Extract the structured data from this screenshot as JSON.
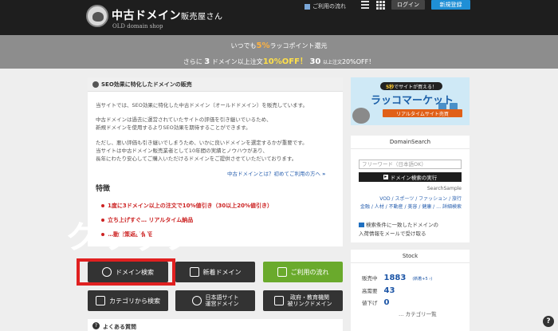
{
  "header": {
    "logo_title": "中古ドメイン",
    "logo_title_suffix": "販売屋さん",
    "logo_sub": "OLD domain shop",
    "flow_label": "ご利用の流れ",
    "login_label": "ログイン",
    "register_label": "新規登録"
  },
  "campaign": {
    "line1_pre": "いつでも",
    "line1_pct": "5%",
    "line1_post": "ラッコポイント還元",
    "line2_pre": "さらに",
    "line2_num": "3",
    "line2_mid": "ドメイン以上注文",
    "line2_off": "10%OFF！",
    "line2_tiny_num": "30",
    "line2_tiny": "以上注文",
    "line2_end": "20%OFF！"
  },
  "main": {
    "title": "SEO効果に特化したドメインの販売",
    "paragraphs": [
      "当サイトでは、SEO効果に特化した中古ドメイン（オールドドメイン）を販売しています。",
      "中古ドメインは過去に運営されていたサイトの評価を引き継いでいるため、",
      "新規ドメインを使用するよりSEO効果を期待することができます。",
      "ただし、悪い評価も引き継いでしまうため、いかに良いドメインを選定するかが重要です。",
      "当サイトは中古ドメイン販売業者として10年間の実績とノウハウがあり、",
      "長年にわたり安心してご購入いただけるドメインをご提供させていただいております。"
    ],
    "first_link": "中古ドメインとは？初めてご利用の方へ",
    "features_heading": "特徴",
    "features": [
      "1度に3ドメイン以上の注文で10%値引き（30以上20%値引き）",
      "立ち上げすぐ… リアルタイム納品",
      "…動対策返品保証"
    ]
  },
  "overlay_text": "クリック",
  "actions": {
    "domain_search": "ドメイン検索",
    "new_domain": "新着ドメイン",
    "usage_flow": "ご利用の流れ",
    "category_search": "カテゴリから検索",
    "jp_site_line1": "日本語サイト",
    "jp_site_line2": "運営ドメイン",
    "gov_line1": "政府・教育機関",
    "gov_line2": "被リンクドメイン"
  },
  "faq": {
    "title": "よくある質問",
    "q_mark": "?"
  },
  "banner": {
    "top_pre": "5秒",
    "top_post": "でサイトが買える！",
    "main": "ラッコマーケット",
    "sub": "リアルタイムサイト売買"
  },
  "domain_search": {
    "heading": "DomainSearch",
    "placeholder": "フリーワード（日本語OK）",
    "button": "ドメイン検索の実行",
    "sample_label": "SearchSample",
    "links_line1": "VOD / スポーツ / ファッション / 旅行",
    "links_line2": "金融 / 人材 / 不動産 / 美容 / 健康 / … 詳細検索",
    "notice_line1": "検索条件に一致したドメインの",
    "notice_line2": "入荷情報をメールで受け取る"
  },
  "stock": {
    "heading": "Stock",
    "rows": [
      {
        "label": "販売中",
        "value": "1883",
        "small": "(新着+5 ›)"
      },
      {
        "label": "高需要",
        "value": "43",
        "small": ""
      },
      {
        "label": "値下げ",
        "value": "0",
        "small": ""
      }
    ],
    "more": "… カテゴリ一覧"
  },
  "help_label": "?",
  "colors": {
    "header_bg": "#1e1e1e",
    "campaign_bg": "#8d8d8d",
    "accent_orange": "#ffb23f",
    "green_button": "#6aaa2c",
    "highlight_red": "#e02020",
    "link_blue": "#2b62b0"
  }
}
